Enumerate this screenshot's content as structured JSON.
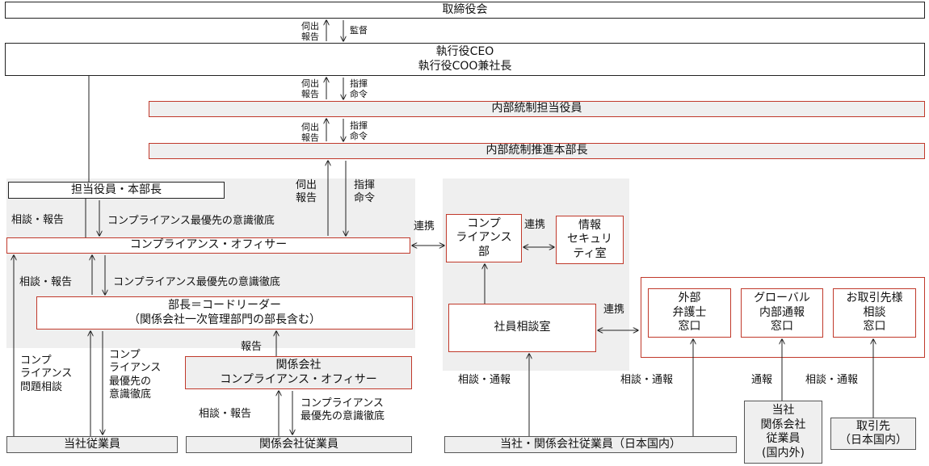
{
  "boxes": {
    "board": "取締役会",
    "ceo": "執行役CEO\n執行役COO兼社長",
    "ic_officer": "内部統制担当役員",
    "ic_director": "内部統制推進本部長",
    "exec_head": "担当役員・本部長",
    "comp_officer": "コンプライアンス・オフィサー",
    "coordinator": "部長＝コードリーダー\n（関係会社一次管理部門の部長含む）",
    "affiliate_co": "関係会社\nコンプライアンス・オフィサー",
    "our_employees": "当社従業員",
    "affiliate_employees": "関係会社従業員",
    "comp_dept": "コンプ\nライアンス\n部",
    "infosec": "情報\nセキュリ\nティ室",
    "consult_room": "社員相談室",
    "lawyer": "外部\n弁護士\n窓口",
    "global": "グローバル\n内部通報\n窓口",
    "partner": "お取引先様\n相談\n窓口",
    "all_employees": "当社・関係会社従業員（日本国内）",
    "group_employees": "当社\n関係会社\n従業員\n(国内外)",
    "partners": "取引先\n（日本国内）"
  },
  "labels": {
    "report_up1": "伺出\n報告",
    "supervise": "監督",
    "report_up2": "伺出\n報告",
    "command1": "指揮\n命令",
    "report_up3": "伺出\n報告",
    "command2": "指揮\n命令",
    "report_up4": "伺出\n報告",
    "command3": "指揮\n命令",
    "consult1": "相談・報告",
    "priority1": "コンプライアンス最優先の意識徹底",
    "consult2": "相談・報告",
    "priority2": "コンプライアンス最優先の意識徹底",
    "comp_issue": "コンプ\nライアンス\n問題相談",
    "priority3": "コンプ\nライアンス\n最優先の\n意識徹底",
    "report": "報告",
    "consult3": "相談・報告",
    "priority4": "コンプライアンス\n最優先の意識徹底",
    "link1": "連携",
    "link2": "連携",
    "link3": "連携",
    "consult_report1": "相談・通報",
    "consult_report2": "相談・通報",
    "whistle": "通報",
    "consult_report3": "相談・通報"
  },
  "colors": {
    "accent_border": "#c0392b",
    "panel_bg": "#efefef",
    "line": "#222222"
  }
}
